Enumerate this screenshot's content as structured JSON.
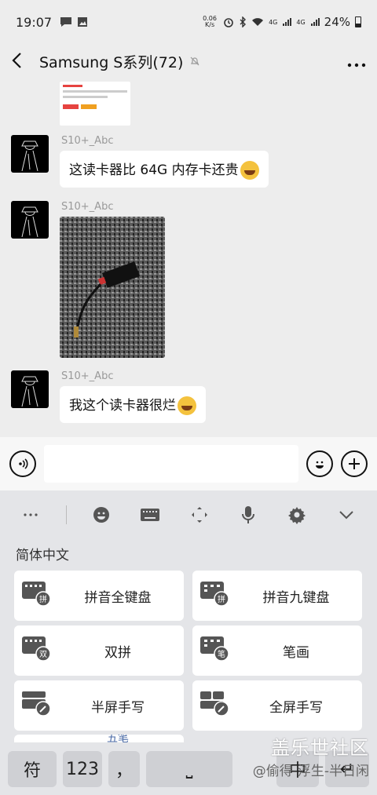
{
  "status": {
    "time": "19:07",
    "net_speed_value": "0.06",
    "net_speed_unit": "K/s",
    "net1": "4G",
    "net2": "4G",
    "battery": "24%"
  },
  "header": {
    "back_icon": "chevron-left-icon",
    "title": "Samsung S系列(72)",
    "muted_icon": "bell-off-icon",
    "more_icon": "more-dots-icon"
  },
  "messages": [
    {
      "sender": "S10+_Abc",
      "type": "text",
      "text": "这读卡器比 64G 内存卡还贵",
      "emoji": "laugh-cry-emoji"
    },
    {
      "sender": "S10+_Abc",
      "type": "image",
      "image": "card-reader-photo"
    },
    {
      "sender": "S10+_Abc",
      "type": "text",
      "text": "我这个读卡器很烂",
      "emoji": "wry-emoji"
    }
  ],
  "input": {
    "voice_icon": "voice-icon",
    "emoji_icon": "emoji-icon",
    "add_icon": "plus-circle-icon"
  },
  "keyboard": {
    "section_label": "简体中文",
    "layouts": [
      {
        "label": "拼音全键盘",
        "badge": "拼"
      },
      {
        "label": "拼音九键盘",
        "badge": "拼"
      },
      {
        "label": "双拼",
        "badge": "双"
      },
      {
        "label": "笔画",
        "badge": "笔"
      },
      {
        "label": "半屏手写",
        "badge": ""
      },
      {
        "label": "全屏手写",
        "badge": ""
      }
    ],
    "partial_label": "五笔",
    "keys": {
      "symbol": "符",
      "num": "123",
      "comma": "，",
      "space": "⎵",
      "lang": "中",
      "enter": "↵"
    }
  },
  "watermark": {
    "line1": "盖乐世社区",
    "line2": "@偷得-浮生-半日闲"
  }
}
